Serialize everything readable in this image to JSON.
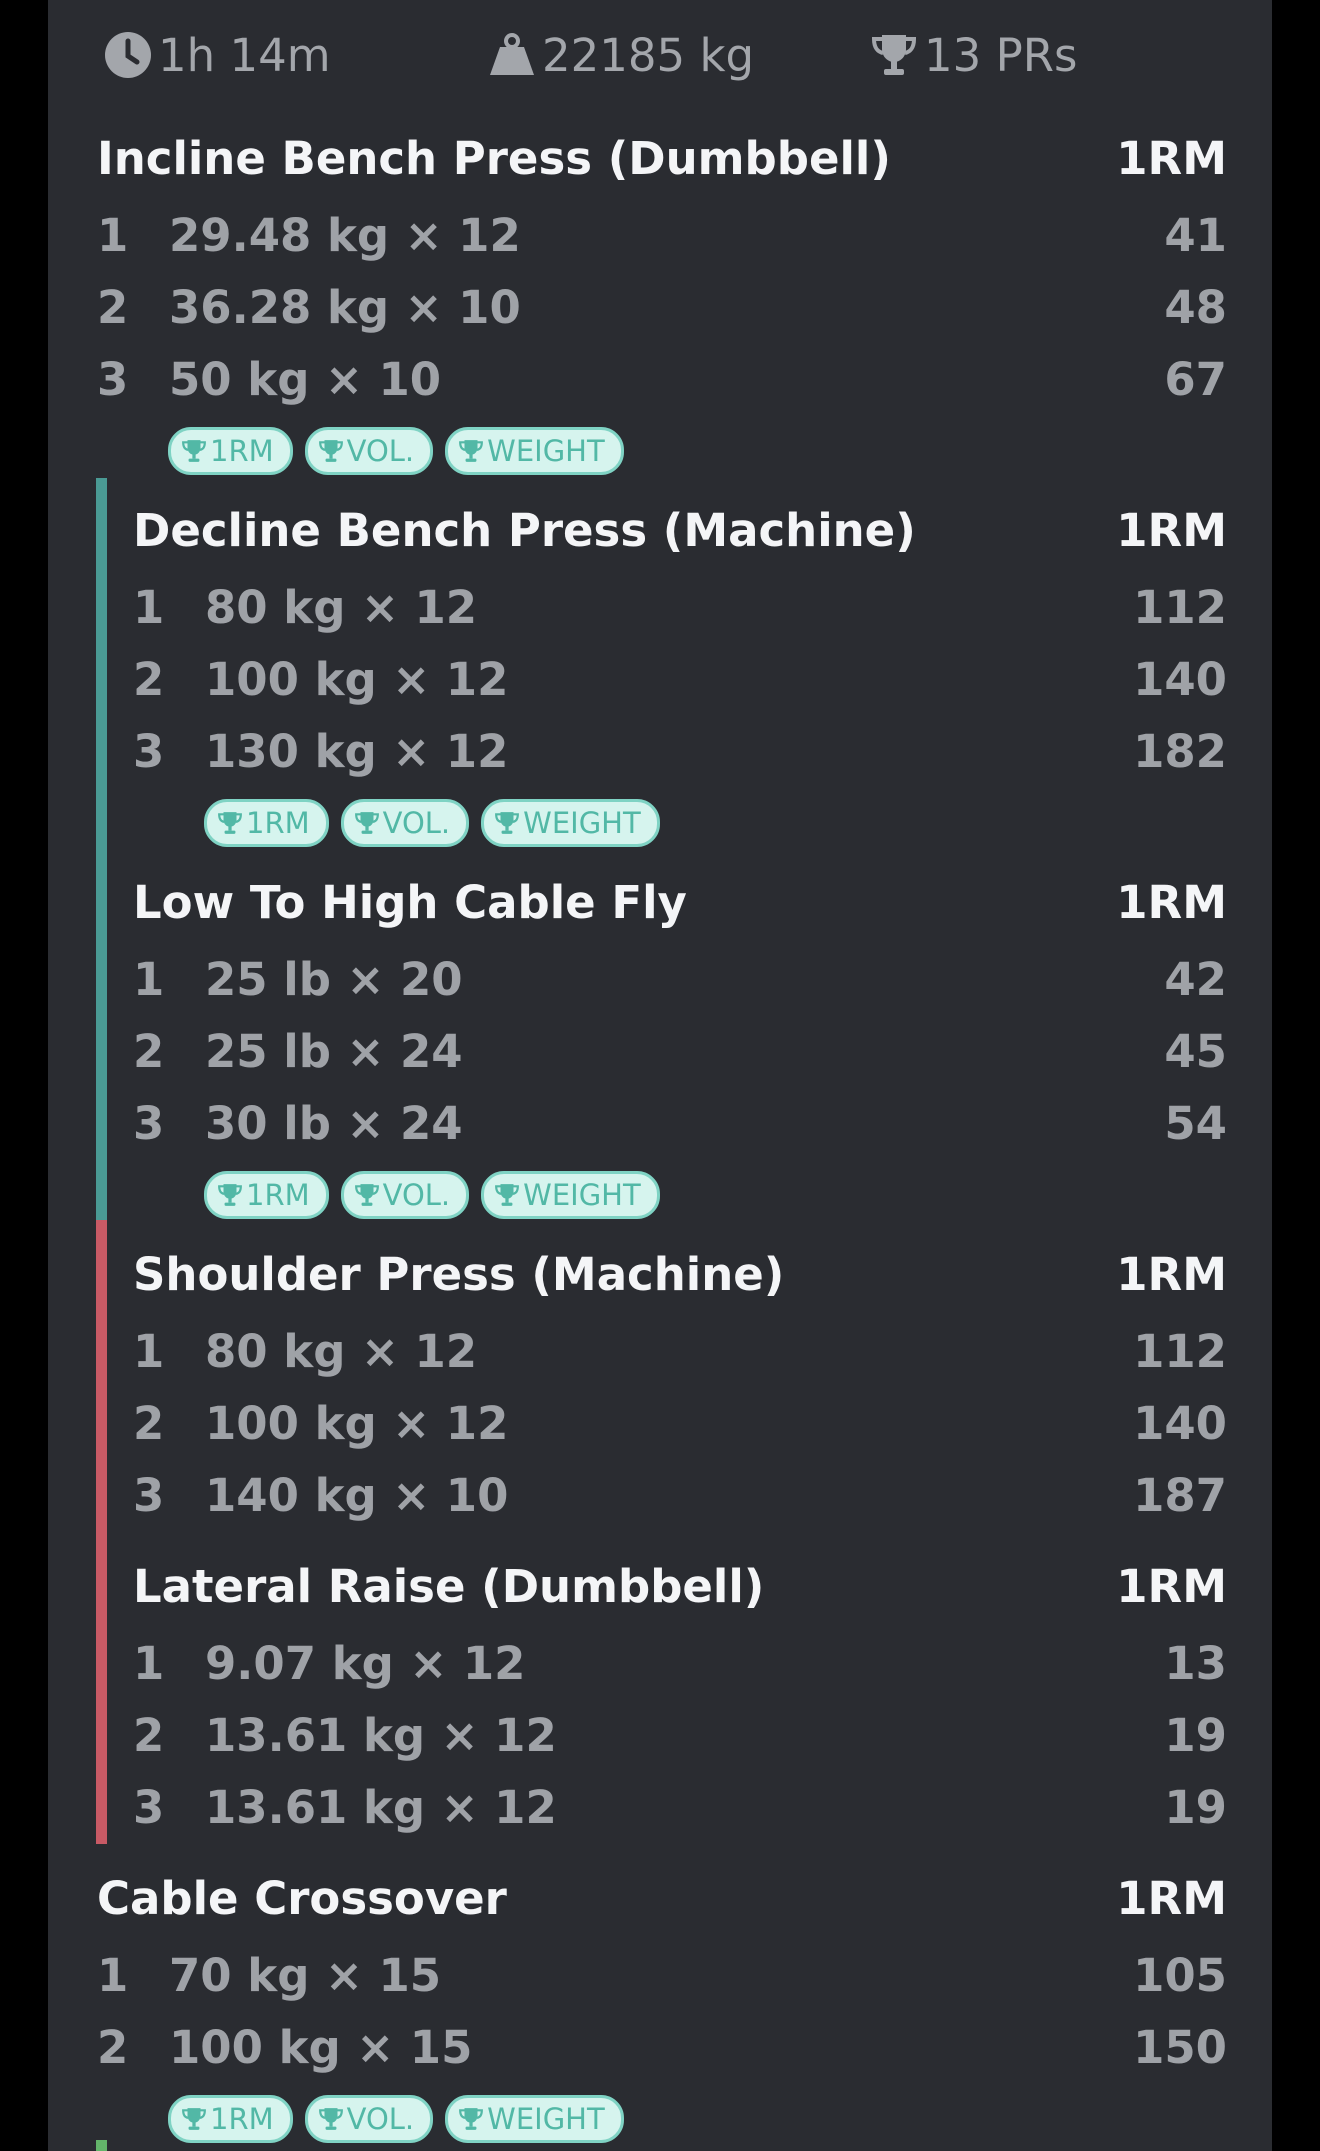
{
  "summary": {
    "duration": "1h 14m",
    "volume": "22185 kg",
    "prs": "13 PRs"
  },
  "colors": {
    "background": "#2a2c31",
    "superset_a": "#4a9a94",
    "superset_b": "#c85a65",
    "superset_c": "#63b46a",
    "badge_fill": "#d6f4ee",
    "badge_text": "#52b8a6"
  },
  "badge_labels": {
    "one_rm": "1RM",
    "volume": "VOL.",
    "weight": "WEIGHT"
  },
  "exercises": [
    {
      "title": "Incline Bench Press (Dumbbell)",
      "metric": "1RM",
      "sets": [
        {
          "num": "1",
          "value": "29.48 kg × 12",
          "one_rm": "41"
        },
        {
          "num": "2",
          "value": "36.28 kg × 10",
          "one_rm": "48"
        },
        {
          "num": "3",
          "value": "50 kg × 10",
          "one_rm": "67"
        }
      ]
    },
    {
      "title": "Decline Bench Press (Machine)",
      "metric": "1RM",
      "sets": [
        {
          "num": "1",
          "value": "80 kg × 12",
          "one_rm": "112"
        },
        {
          "num": "2",
          "value": "100 kg × 12",
          "one_rm": "140"
        },
        {
          "num": "3",
          "value": "130 kg × 12",
          "one_rm": "182"
        }
      ]
    },
    {
      "title": "Low To High Cable Fly",
      "metric": "1RM",
      "sets": [
        {
          "num": "1",
          "value": "25 lb × 20",
          "one_rm": "42"
        },
        {
          "num": "2",
          "value": "25 lb × 24",
          "one_rm": "45"
        },
        {
          "num": "3",
          "value": "30 lb × 24",
          "one_rm": "54"
        }
      ]
    },
    {
      "title": "Shoulder Press (Machine)",
      "metric": "1RM",
      "sets": [
        {
          "num": "1",
          "value": "80 kg × 12",
          "one_rm": "112"
        },
        {
          "num": "2",
          "value": "100 kg × 12",
          "one_rm": "140"
        },
        {
          "num": "3",
          "value": "140 kg × 10",
          "one_rm": "187"
        }
      ]
    },
    {
      "title": "Lateral Raise (Dumbbell)",
      "metric": "1RM",
      "sets": [
        {
          "num": "1",
          "value": "9.07 kg × 12",
          "one_rm": "13"
        },
        {
          "num": "2",
          "value": "13.61 kg × 12",
          "one_rm": "19"
        },
        {
          "num": "3",
          "value": "13.61 kg × 12",
          "one_rm": "19"
        }
      ]
    },
    {
      "title": "Cable Crossover",
      "metric": "1RM",
      "sets": [
        {
          "num": "1",
          "value": "70 kg × 15",
          "one_rm": "105"
        },
        {
          "num": "2",
          "value": "100 kg × 15",
          "one_rm": "150"
        }
      ]
    }
  ]
}
